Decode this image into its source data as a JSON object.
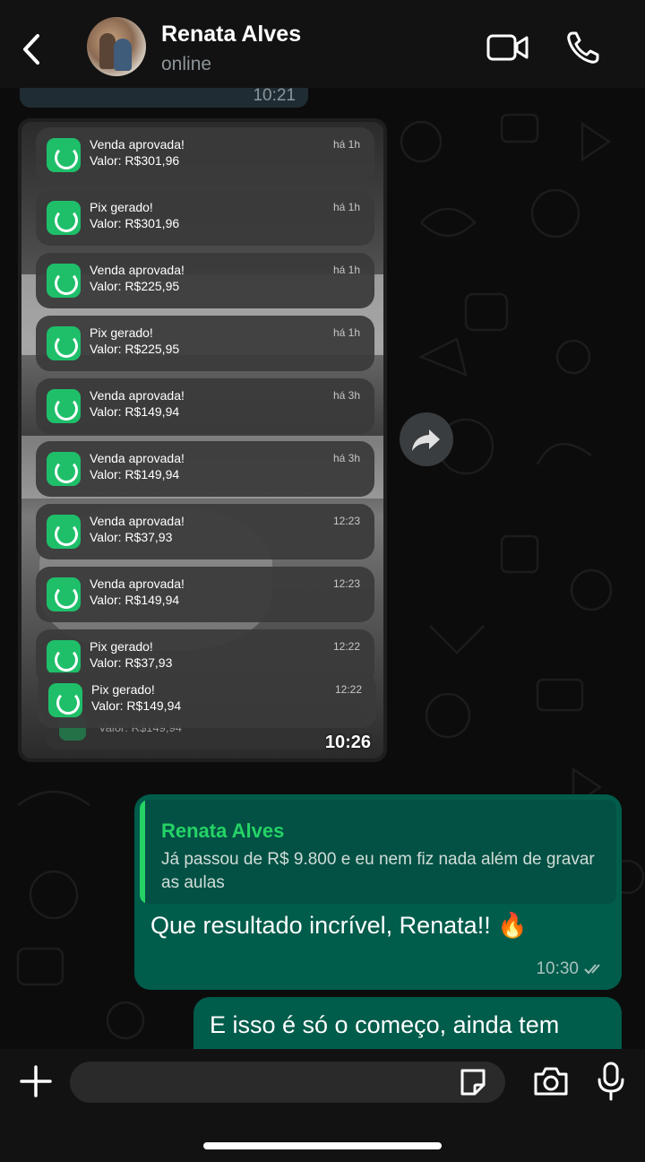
{
  "header": {
    "contact_name": "Renata Alves",
    "status": "online"
  },
  "previous_message": {
    "time": "10:21"
  },
  "image_message": {
    "time": "10:26",
    "notifications": [
      {
        "title": "Venda aprovada!",
        "body": "Valor: R$301,96",
        "time": "há 1h"
      },
      {
        "title": "Pix gerado!",
        "body": "Valor: R$301,96",
        "time": "há 1h"
      },
      {
        "title": "Venda aprovada!",
        "body": "Valor: R$225,95",
        "time": "há 1h"
      },
      {
        "title": "Pix gerado!",
        "body": "Valor: R$225,95",
        "time": "há 1h"
      },
      {
        "title": "Venda aprovada!",
        "body": "Valor: R$149,94",
        "time": "há 3h"
      },
      {
        "title": "Venda aprovada!",
        "body": "Valor: R$149,94",
        "time": "há 3h"
      },
      {
        "title": "Venda aprovada!",
        "body": "Valor: R$37,93",
        "time": "12:23"
      },
      {
        "title": "Venda aprovada!",
        "body": "Valor: R$149,94",
        "time": "12:23"
      },
      {
        "title": "Pix gerado!",
        "body": "Valor: R$37,93",
        "time": "12:22"
      },
      {
        "title": "Pix gerado!",
        "body": "Valor: R$149,94",
        "time": "12:22"
      }
    ],
    "hidden_notification_body": "Valor: R$149,94"
  },
  "reply_message": {
    "quoted_author": "Renata Alves",
    "quoted_text": "Já passou de R$ 9.800 e eu nem fiz nada além de gravar as aulas",
    "text": "Que resultado incrível, Renata!! 🔥",
    "time": "10:30"
  },
  "partial_message": {
    "text": "E isso é só o começo, ainda tem"
  },
  "colors": {
    "outgoing_bubble": "#005c4b",
    "accent_green": "#25d366",
    "notification_app": "#1fbf6a"
  },
  "icons": [
    "back-arrow-icon",
    "video-call-icon",
    "phone-icon",
    "forward-icon",
    "plus-icon",
    "sticker-icon",
    "camera-icon",
    "microphone-icon",
    "double-check-icon"
  ]
}
